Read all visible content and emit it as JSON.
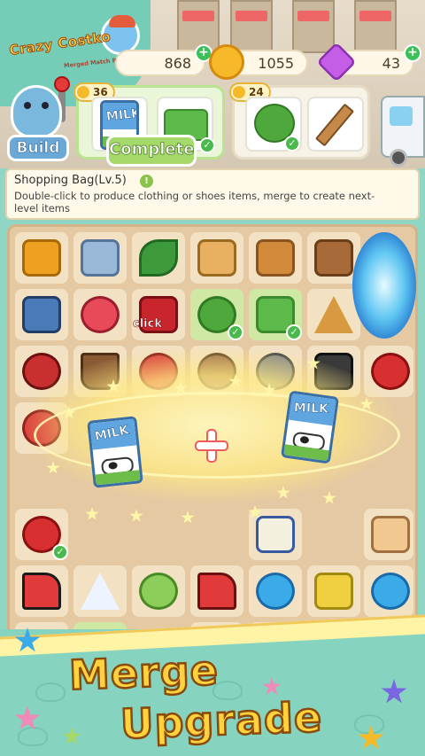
{
  "app": {
    "logo_text": "Crazy Costko",
    "logo_subtitle": "Merged Match Puzzles"
  },
  "currency": {
    "cash": "868",
    "coins": "1055",
    "gems": "43",
    "add_symbol": "+"
  },
  "header": {
    "build_label": "Build",
    "complete_label": "Complete",
    "orders": [
      {
        "reward": "36",
        "items": [
          "milk-carton-icon",
          "wheatgrass-icon"
        ],
        "completed": true
      },
      {
        "reward": "24",
        "items": [
          "shrub-icon",
          "wood-plank-icon"
        ],
        "completed": false
      }
    ]
  },
  "info_panel": {
    "title": "Shopping Bag(Lv.5)",
    "description": "Double-click to produce clothing or shoes items, merge to create next-level items",
    "info_symbol": "!"
  },
  "board": {
    "click_label": "click",
    "merge_items": [
      "milk-carton-icon",
      "milk-carton-icon"
    ],
    "milk_label": "MILK",
    "check_symbol": "✓",
    "item_colors": {
      "microwave": "#f0a020",
      "leaf": "#3c9a3c",
      "apple": "#d83030",
      "sneaker": "#e03a3a",
      "dress": "#ffffff",
      "star_blue": "#3aaae8",
      "shopping_bag": "#c8262c",
      "portal": "#5fc6f2"
    }
  },
  "footer": {
    "slogan_line1": "Merge",
    "slogan_line2": "Upgrade"
  }
}
